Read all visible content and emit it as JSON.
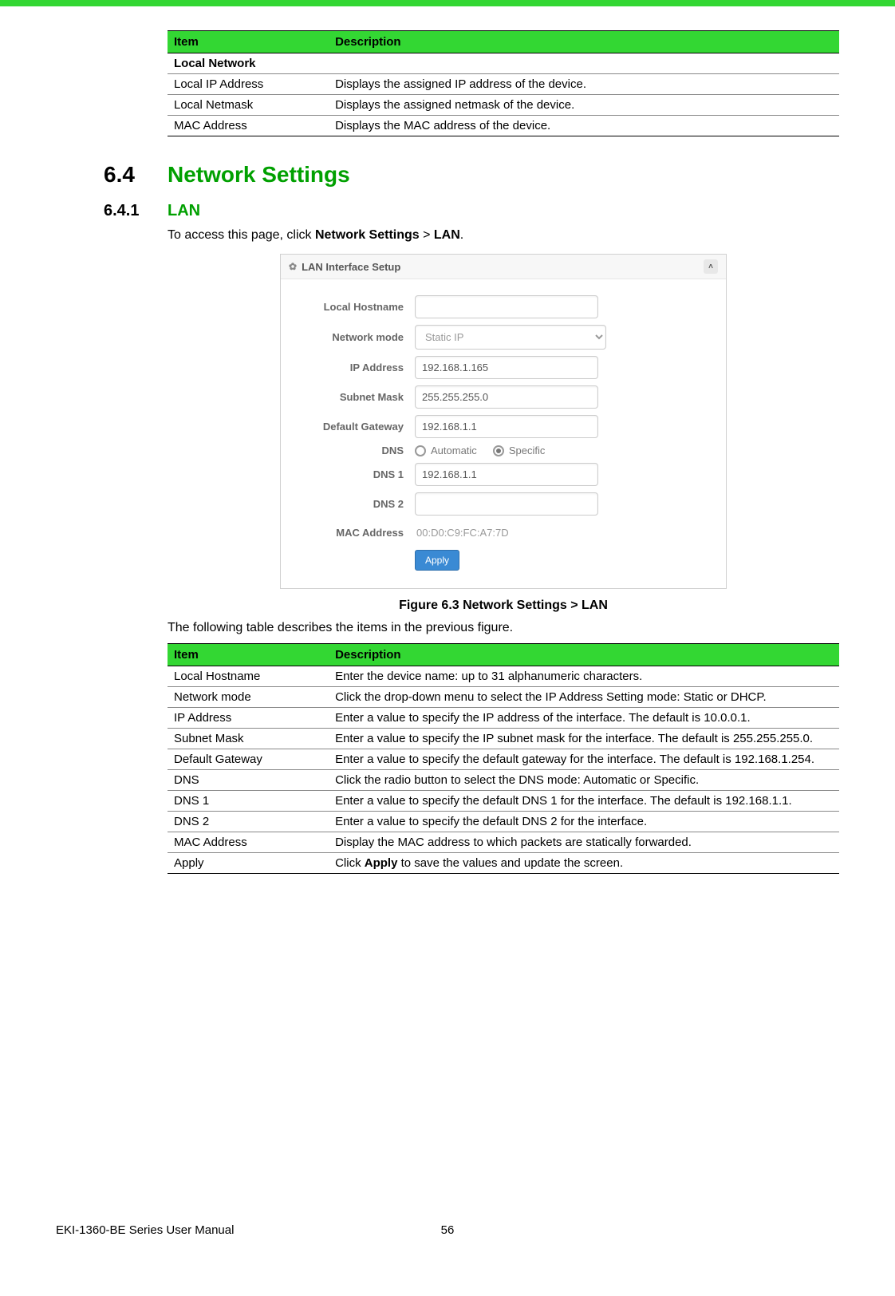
{
  "tables": {
    "header_item": "Item",
    "header_desc": "Description"
  },
  "table1": {
    "section": "Local Network",
    "rows": [
      {
        "item": "Local IP Address",
        "desc": "Displays the assigned IP address of the device."
      },
      {
        "item": "Local Netmask",
        "desc": "Displays the assigned netmask of the device."
      },
      {
        "item": "MAC Address",
        "desc": "Displays the MAC address of the device."
      }
    ]
  },
  "headings": {
    "h64_num": "6.4",
    "h64_title": "Network Settings",
    "h641_num": "6.4.1",
    "h641_title": "LAN"
  },
  "intro": {
    "prefix": "To access this page, click ",
    "b1": "Network Settings",
    "mid": " > ",
    "b2": "LAN",
    "suffix": "."
  },
  "lan_panel": {
    "title": "LAN Interface Setup",
    "labels": {
      "hostname": "Local Hostname",
      "netmode": "Network mode",
      "ip": "IP Address",
      "subnet": "Subnet Mask",
      "gw": "Default Gateway",
      "dns": "DNS",
      "dns1": "DNS 1",
      "dns2": "DNS 2",
      "mac": "MAC Address"
    },
    "values": {
      "hostname": "",
      "netmode": "Static IP",
      "ip": "192.168.1.165",
      "subnet": "255.255.255.0",
      "gw": "192.168.1.1",
      "dns1": "192.168.1.1",
      "dns2": "",
      "mac": "00:D0:C9:FC:A7:7D"
    },
    "dns_options": {
      "auto": "Automatic",
      "spec": "Specific"
    },
    "apply": "Apply"
  },
  "figure_caption": "Figure 6.3 Network Settings > LAN",
  "after_fig": "The following table describes the items in the previous figure.",
  "table2": {
    "rows": [
      {
        "item": "Local Hostname",
        "desc": "Enter the device name: up to 31 alphanumeric characters."
      },
      {
        "item": "Network mode",
        "desc": "Click the drop-down menu to select the IP Address Setting mode: Static or DHCP."
      },
      {
        "item": "IP Address",
        "desc": "Enter a value to specify the IP address of the interface. The default is 10.0.0.1."
      },
      {
        "item": "Subnet Mask",
        "desc": "Enter a value to specify the IP subnet mask for the interface. The default is 255.255.255.0."
      },
      {
        "item": "Default Gateway",
        "desc": "Enter a value to specify the default gateway for the interface. The default is 192.168.1.254."
      },
      {
        "item": "DNS",
        "desc": "Click the radio button to select the DNS mode: Automatic or Specific."
      },
      {
        "item": "DNS 1",
        "desc": "Enter a value to specify the default DNS 1 for the interface. The default is 192.168.1.1."
      },
      {
        "item": "DNS 2",
        "desc": "Enter a value to specify the default DNS 2 for the interface."
      },
      {
        "item": "MAC Address",
        "desc": "Display the MAC address to which packets are statically forwarded."
      },
      {
        "item": "Apply",
        "desc_pre": "Click ",
        "desc_b": "Apply",
        "desc_post": " to save the values and update the screen."
      }
    ]
  },
  "footer": {
    "left": "EKI-1360-BE Series User Manual",
    "page": "56"
  }
}
